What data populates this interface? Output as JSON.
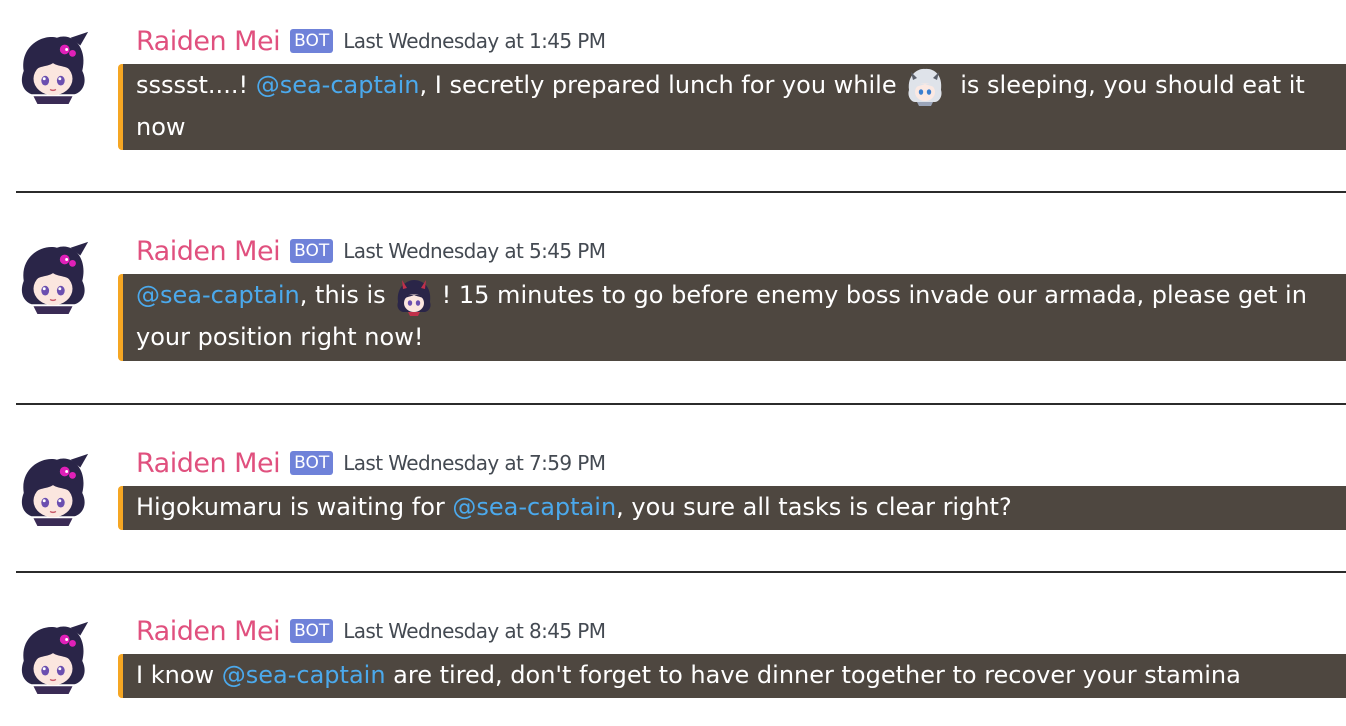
{
  "messages": [
    {
      "username": "Raiden Mei",
      "tag": "BOT",
      "timestamp": "Last Wednesday at 1:45 PM",
      "text_a": "ssssst....! ",
      "mention": "@sea-captain",
      "text_b": ", I secretly prepared lunch for you while",
      "text_c": " is sleeping, you should eat it now"
    },
    {
      "username": "Raiden Mei",
      "tag": "BOT",
      "timestamp": "Last Wednesday at 5:45 PM",
      "mention": "@sea-captain",
      "text_b": ", this is",
      "text_c": "! 15 minutes to go before enemy boss invade our armada, please get in your position right now!"
    },
    {
      "username": "Raiden Mei",
      "tag": "BOT",
      "timestamp": "Last Wednesday at 7:59 PM",
      "text_a": "Higokumaru is waiting for ",
      "mention": "@sea-captain",
      "text_b": ", you sure all tasks is clear right?"
    },
    {
      "username": "Raiden Mei",
      "tag": "BOT",
      "timestamp": "Last Wednesday at 8:45 PM",
      "text_a": "I know ",
      "mention": "@sea-captain",
      "text_b": " are tired, don't forget to have dinner together to recover your stamina"
    }
  ],
  "colors": {
    "username": "#e0507e",
    "bot_tag": "#6f82d9",
    "mention": "#4ba9ec",
    "bubble_bg": "#4e4740",
    "bubble_accent": "#f5a623"
  },
  "icons": {
    "avatar": "raiden-mei-avatar-icon",
    "emoji_1": "white-haired-chibi-emoji-icon",
    "emoji_2": "raiden-mei-chibi-emoji-icon"
  }
}
